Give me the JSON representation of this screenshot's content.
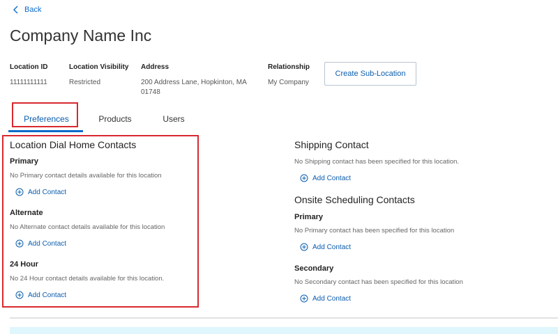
{
  "nav": {
    "back_label": "Back"
  },
  "header": {
    "title": "Company Name Inc"
  },
  "info": {
    "location_id": {
      "label": "Location ID",
      "value": "11111111111"
    },
    "visibility": {
      "label": "Location Visibility",
      "value": "Restricted"
    },
    "address": {
      "label": "Address",
      "line1": "200 Address Lane, Hopkinton, MA",
      "line2": "01748"
    },
    "relationship": {
      "label": "Relationship",
      "value": "My Company"
    }
  },
  "actions": {
    "create_sub_location": "Create Sub-Location"
  },
  "tabs": [
    {
      "label": "Preferences",
      "active": true
    },
    {
      "label": "Products",
      "active": false
    },
    {
      "label": "Users",
      "active": false
    }
  ],
  "dial_home": {
    "title": "Location Dial Home Contacts",
    "primary": {
      "label": "Primary",
      "note": "No Primary contact details available for this location",
      "add": "Add Contact"
    },
    "alternate": {
      "label": "Alternate",
      "note": "No Alternate contact details available for this location",
      "add": "Add Contact"
    },
    "hour24": {
      "label": "24 Hour",
      "note": "No 24 Hour contact details available for this location.",
      "add": "Add Contact"
    }
  },
  "shipping": {
    "title": "Shipping Contact",
    "note": "No Shipping contact has been specified for this location.",
    "add": "Add Contact"
  },
  "onsite": {
    "title": "Onsite Scheduling Contacts",
    "primary": {
      "label": "Primary",
      "note": "No Primary contact has been specified for this location",
      "add": "Add Contact"
    },
    "secondary": {
      "label": "Secondary",
      "note": "No Secondary contact has been specified for this location",
      "add": "Add Contact"
    }
  },
  "colors": {
    "accent": "#0b5cad",
    "highlight": "#d8282e",
    "banner": "#dff6fc"
  },
  "icons": {
    "back": "chevron-left-icon",
    "add": "plus-circle-icon"
  }
}
